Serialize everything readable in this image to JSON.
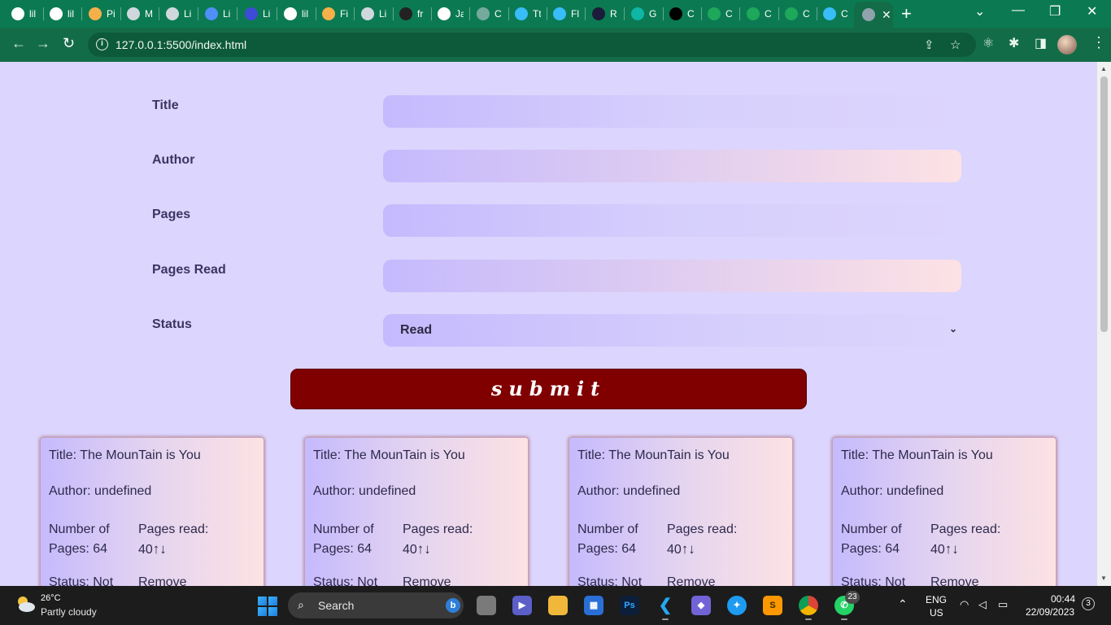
{
  "browser": {
    "tabs": [
      {
        "label": "lil",
        "icon": "github-icon",
        "color": "#ffffff"
      },
      {
        "label": "lil",
        "icon": "github-icon",
        "color": "#ffffff"
      },
      {
        "label": "Pi",
        "icon": "fox-icon",
        "color": "#f5b04a"
      },
      {
        "label": "M",
        "icon": "globe-icon",
        "color": "#cfd8dc"
      },
      {
        "label": "Li",
        "icon": "globe-icon",
        "color": "#cfd8dc"
      },
      {
        "label": "Li",
        "icon": "doc-icon",
        "color": "#4f8ff7"
      },
      {
        "label": "Li",
        "icon": "book-icon",
        "color": "#3d4bd6"
      },
      {
        "label": "lil",
        "icon": "github-icon",
        "color": "#ffffff"
      },
      {
        "label": "Fi",
        "icon": "fox-icon",
        "color": "#f5b04a"
      },
      {
        "label": "Li",
        "icon": "globe-icon",
        "color": "#cfd8dc"
      },
      {
        "label": "fr",
        "icon": "bracket-icon",
        "color": "#222222"
      },
      {
        "label": "Ja",
        "icon": "github-icon",
        "color": "#ffffff"
      },
      {
        "label": "C",
        "icon": "openai-icon",
        "color": "#74aa9c"
      },
      {
        "label": "Tt",
        "icon": "tailwind-icon",
        "color": "#38bdf8"
      },
      {
        "label": "Fl",
        "icon": "tailwind-icon",
        "color": "#38bdf8"
      },
      {
        "label": "R",
        "icon": "r-icon",
        "color": "#1b1b3a"
      },
      {
        "label": "G",
        "icon": "diamond-icon",
        "color": "#0fb5a5"
      },
      {
        "label": "C",
        "icon": "triangle-icon",
        "color": "#000000"
      },
      {
        "label": "C",
        "icon": "w-icon",
        "color": "#1ea85a"
      },
      {
        "label": "C",
        "icon": "w-icon",
        "color": "#1ea85a"
      },
      {
        "label": "C",
        "icon": "w-icon",
        "color": "#1ea85a"
      },
      {
        "label": "C",
        "icon": "tailwind-icon",
        "color": "#38bdf8"
      }
    ],
    "url": "127.0.0.1:5500/index.html"
  },
  "form": {
    "title_label": "Title",
    "author_label": "Author",
    "pages_label": "Pages",
    "pages_read_label": "Pages Read",
    "status_label": "Status",
    "status_value": "Read",
    "submit_label": "submit"
  },
  "cards": [
    {
      "title": "Title: The MounTain is You",
      "author": "Author: undefined",
      "pages_line1": "Number of",
      "pages_line2": "Pages: 64",
      "read_line1": "Pages read:",
      "read_line2": "40",
      "status": "Status: Not",
      "remove": "Remove"
    },
    {
      "title": "Title: The MounTain is You",
      "author": "Author: undefined",
      "pages_line1": "Number of",
      "pages_line2": "Pages: 64",
      "read_line1": "Pages read:",
      "read_line2": "40",
      "status": "Status: Not",
      "remove": "Remove"
    },
    {
      "title": "Title: The MounTain is You",
      "author": "Author: undefined",
      "pages_line1": "Number of",
      "pages_line2": "Pages: 64",
      "read_line1": "Pages read:",
      "read_line2": "40",
      "status": "Status: Not",
      "remove": "Remove"
    },
    {
      "title": "Title: The MounTain is You",
      "author": "Author: undefined",
      "pages_line1": "Number of",
      "pages_line2": "Pages: 64",
      "read_line1": "Pages read:",
      "read_line2": "40",
      "status": "Status: Not",
      "remove": "Remove"
    }
  ],
  "taskbar": {
    "weather_temp": "26°C",
    "weather_desc": "Partly cloudy",
    "search_label": "Search",
    "whatsapp_badge": "23",
    "lang_line1": "ENG",
    "lang_line2": "US",
    "time": "00:44",
    "date": "22/09/2023",
    "notifications": "3"
  },
  "colors": {
    "page_bg": "#dcd5fd",
    "submit_bg": "#800000",
    "chrome_green": "#0b7a52"
  }
}
